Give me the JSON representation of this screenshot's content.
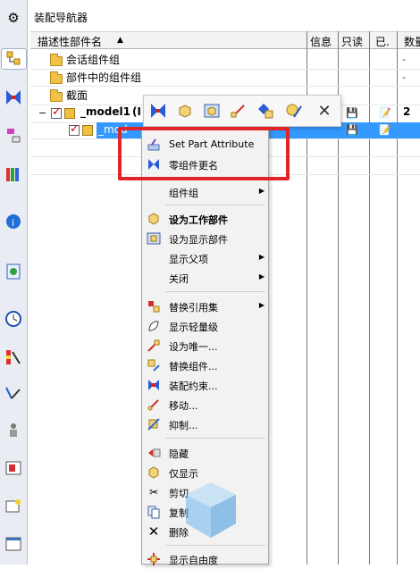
{
  "panel_title": "装配导航器",
  "columns": {
    "name": "描述性部件名",
    "sort_indicator": "▲",
    "info": "信息",
    "readonly": "只读",
    "modified": "已.",
    "count": "数量"
  },
  "tree": {
    "session_groups": "会话组件组",
    "part_groups": "部件中的组件组",
    "sections": "截面",
    "root_name": "_model1",
    "root_suffix": "(I",
    "root_count": "2",
    "child_name": "_mod",
    "dash": "-"
  },
  "context_menu": {
    "set_part_attribute": "Set Part Attribute",
    "rename_component": "零组件更名",
    "component_group": "组件组",
    "make_work_part": "设为工作部件",
    "make_displayed_part": "设为显示部件",
    "show_parent": "显示父项",
    "close": "关闭",
    "replace_reference_set": "替换引用集",
    "show_lightweight": "显示轻量级",
    "make_unique": "设为唯一...",
    "replace_component": "替换组件...",
    "assembly_constraints": "装配约束...",
    "move": "移动...",
    "suppress": "抑制...",
    "hide": "隐藏",
    "show_only": "仅显示",
    "cut": "剪切",
    "copy": "复制",
    "delete": "删除",
    "show_dof": "显示自由度"
  },
  "icons": {
    "left_bar": [
      "gear-icon",
      "assembly-navigator-icon",
      "constraint-navigator-icon",
      "part-navigator-icon",
      "reuse-library-icon",
      "web-browser-icon",
      "history-icon",
      "clock-icon",
      "visualization-icon",
      "process-icon",
      "roles-icon",
      "sheet-icon",
      "system-icon"
    ]
  },
  "colors": {
    "selection": "#3399ff",
    "highlight_box": "#e0242a"
  }
}
